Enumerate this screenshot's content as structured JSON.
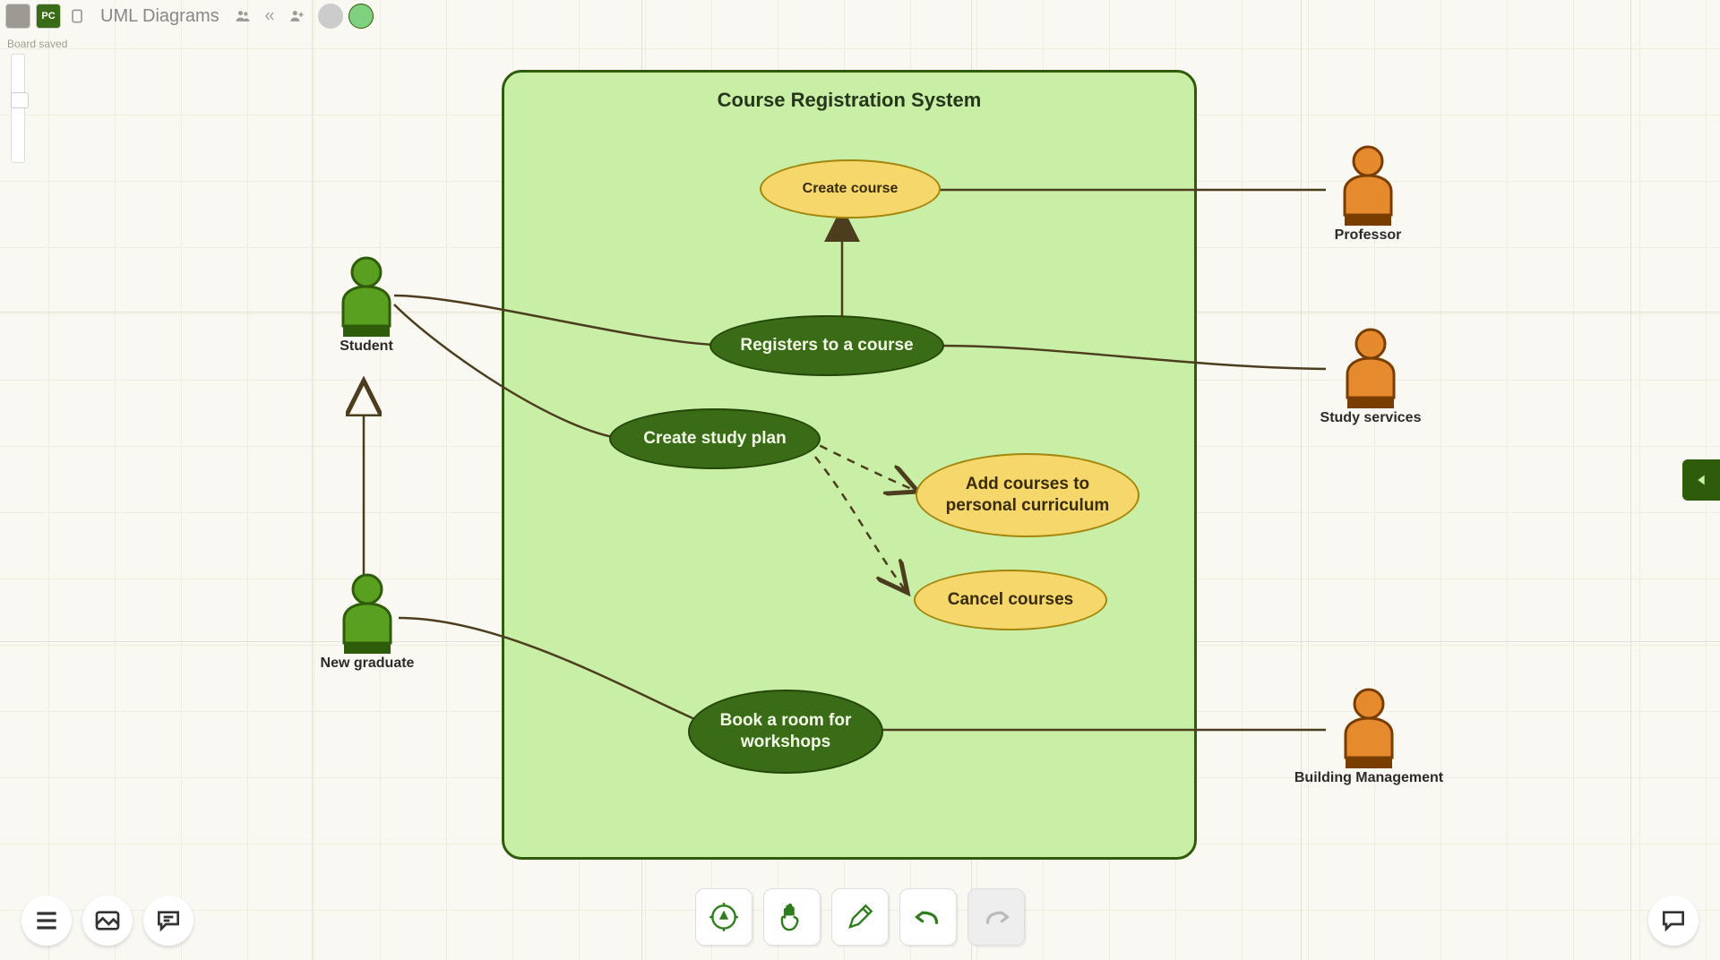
{
  "header": {
    "title": "UML Diagrams",
    "avatars": [
      {
        "label": "",
        "color": "#9d9993"
      },
      {
        "label": "PC",
        "color": "#3a6b16"
      }
    ]
  },
  "status": "Board saved",
  "system": {
    "title": "Course Registration System"
  },
  "usecases": {
    "create_course": "Create course",
    "registers": "Registers to a course",
    "create_plan": "Create study plan",
    "add_courses": "Add courses to personal curriculum",
    "cancel_courses": "Cancel courses",
    "book_room": "Book a room for workshops"
  },
  "actors": {
    "student": "Student",
    "new_grad": "New graduate",
    "professor": "Professor",
    "study_services": "Study services",
    "building": "Building Management"
  }
}
